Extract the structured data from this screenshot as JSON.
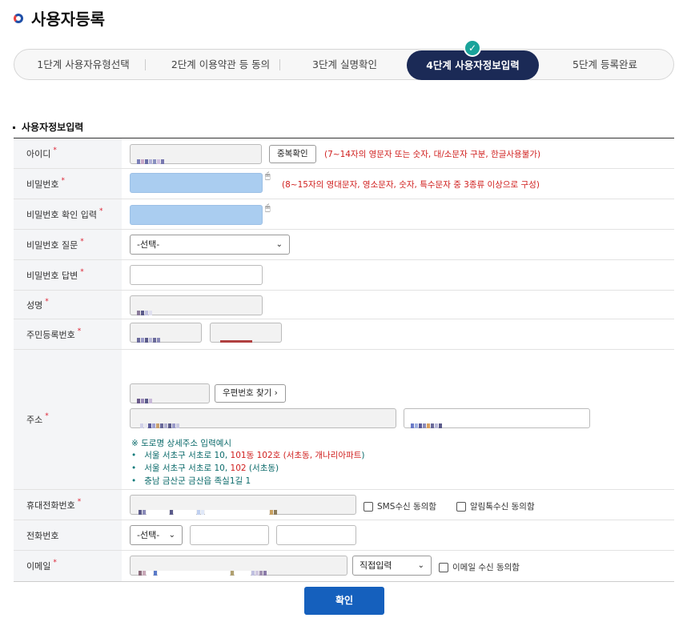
{
  "page": {
    "title": "사용자등록"
  },
  "steps": [
    {
      "label": "1단계 사용자유형선택"
    },
    {
      "label": "2단계 이용약관 등 동의"
    },
    {
      "label": "3단계 실명확인"
    },
    {
      "label": "4단계 사용자정보입력",
      "active": true
    },
    {
      "label": "5단계 등록완료"
    }
  ],
  "section": {
    "title": "사용자정보입력"
  },
  "fields": {
    "id": {
      "label": "아이디",
      "check_button": "중복확인",
      "note": "(7~14자의 영문자 또는 숫자, 대/소문자 구분, 한글사용불가)"
    },
    "password": {
      "label": "비밀번호",
      "note": "(8~15자의 영대문자, 영소문자, 숫자, 특수문자 중 3종류 이상으로 구성)"
    },
    "password_confirm": {
      "label": "비밀번호 확인 입력"
    },
    "pw_question": {
      "label": "비밀번호 질문",
      "selected": "-선택-"
    },
    "pw_answer": {
      "label": "비밀번호 답변"
    },
    "name": {
      "label": "성명"
    },
    "rrn": {
      "label": "주민등록번호"
    },
    "address": {
      "label": "주소",
      "zip_button": "우편번호 찾기 ›",
      "guide_title": "※ 도로명 상세주소 입력예시",
      "guide_1a": "서울 서초구 서초로 10, ",
      "guide_1b": "101",
      "guide_1c": "동 ",
      "guide_1d": "102",
      "guide_1e": "호 (서초동, ",
      "guide_1f": "개나리아파트",
      "guide_1g": ")",
      "guide_2a": "서울 서초구 서초로 10, ",
      "guide_2b": "102",
      "guide_2c": " (서초동)",
      "guide_3": "충남 금산군 금산읍 족실1길 1"
    },
    "mobile": {
      "label": "휴대전화번호",
      "sms_consent": "SMS수신 동의함",
      "kakao_consent": "알림톡수신 동의함"
    },
    "phone": {
      "label": "전화번호",
      "selected": "-선택-"
    },
    "email": {
      "label": "이메일",
      "domain_select": "직접입력",
      "email_consent": "이메일 수신 동의함"
    }
  },
  "buttons": {
    "confirm": "확인"
  },
  "colors": {
    "primary": "#1560bd",
    "step_active": "#1b2a56",
    "check_badge": "#1aa39a",
    "required": "#dd2233"
  }
}
